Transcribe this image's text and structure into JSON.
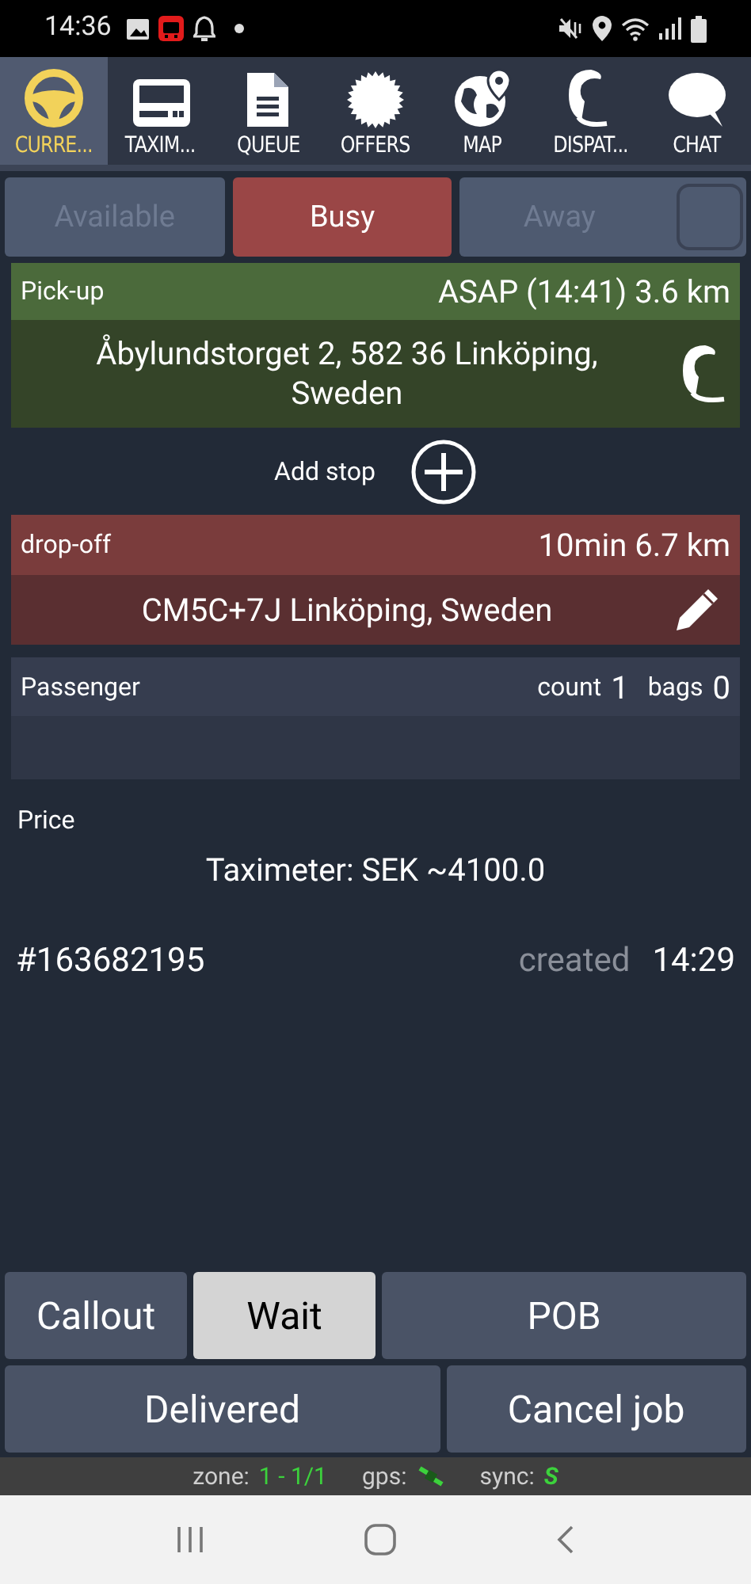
{
  "status_bar": {
    "time": "14:36"
  },
  "tabs": [
    {
      "label": "CURRE...",
      "kind": "wheel",
      "selected": true
    },
    {
      "label": "TAXIM...",
      "kind": "meter",
      "selected": false
    },
    {
      "label": "QUEUE",
      "kind": "doc",
      "selected": false
    },
    {
      "label": "OFFERS",
      "kind": "badge",
      "selected": false
    },
    {
      "label": "MAP",
      "kind": "globe",
      "selected": false
    },
    {
      "label": "DISPAT...",
      "kind": "headset",
      "selected": false
    },
    {
      "label": "CHAT",
      "kind": "bubble",
      "selected": false
    }
  ],
  "availability": [
    {
      "label": "Available",
      "selected": false
    },
    {
      "label": "Busy",
      "selected": true
    },
    {
      "label": "Away",
      "selected": false
    }
  ],
  "pickup": {
    "label": "Pick-up",
    "info": "ASAP (14:41) 3.6 km",
    "address": "Åbylundstorget 2, 582 36 Linköping, Sweden"
  },
  "add_stop": {
    "label": "Add stop"
  },
  "dropoff": {
    "label": "drop-off",
    "info": "10min 6.7 km",
    "address": "CM5C+7J Linköping, Sweden"
  },
  "passenger": {
    "label": "Passenger",
    "count_label": "count",
    "count": "1",
    "bags_label": "bags",
    "bags": "0"
  },
  "price": {
    "label": "Price",
    "value": "Taximeter: SEK ~4100.0"
  },
  "job": {
    "id": "#163682195",
    "created_label": "created",
    "created": "14:29"
  },
  "actions": [
    [
      {
        "label": "Callout",
        "selected": false
      },
      {
        "label": "Wait",
        "selected": true
      },
      {
        "label": "POB",
        "selected": false
      }
    ],
    [
      {
        "label": "Delivered",
        "selected": false
      },
      {
        "label": "Cancel job",
        "selected": false
      }
    ]
  ],
  "footer": {
    "zone_label": "zone:",
    "zone": "1 - 1/1",
    "gps_label": "gps:",
    "sync_label": "sync:",
    "sync": "S"
  }
}
